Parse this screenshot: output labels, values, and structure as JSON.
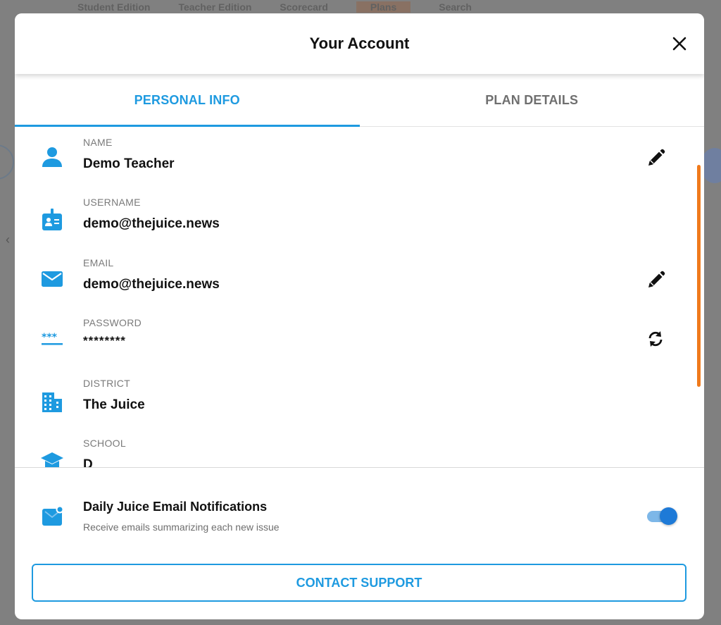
{
  "background": {
    "nav_items": [
      "Student Edition",
      "Teacher Edition",
      "Scorecard",
      "Plans",
      "Search"
    ]
  },
  "modal": {
    "title": "Your Account",
    "close_icon": "close-icon"
  },
  "tabs": [
    {
      "label": "PERSONAL INFO",
      "active": true
    },
    {
      "label": "PLAN DETAILS",
      "active": false
    }
  ],
  "fields": [
    {
      "label": "NAME",
      "value": "Demo Teacher",
      "icon": "person-icon",
      "action": "edit-icon"
    },
    {
      "label": "USERNAME",
      "value": "demo@thejuice.news",
      "icon": "badge-icon",
      "action": null
    },
    {
      "label": "EMAIL",
      "value": "demo@thejuice.news",
      "icon": "mail-icon",
      "action": "edit-icon"
    },
    {
      "label": "PASSWORD",
      "value": "********",
      "icon": "password-icon",
      "action": "refresh-icon"
    },
    {
      "label": "DISTRICT",
      "value": "The Juice",
      "icon": "building-icon",
      "action": null
    },
    {
      "label": "SCHOOL",
      "value": "D",
      "icon": "school-icon",
      "action": null
    }
  ],
  "notification": {
    "title": "Daily Juice Email Notifications",
    "subtitle": "Receive emails summarizing each new issue",
    "enabled": true
  },
  "support_button": "CONTACT SUPPORT",
  "colors": {
    "accent": "#1e9ae0",
    "toggle_on": "#1e7ad7",
    "scrollbar": "#f07a1c"
  }
}
